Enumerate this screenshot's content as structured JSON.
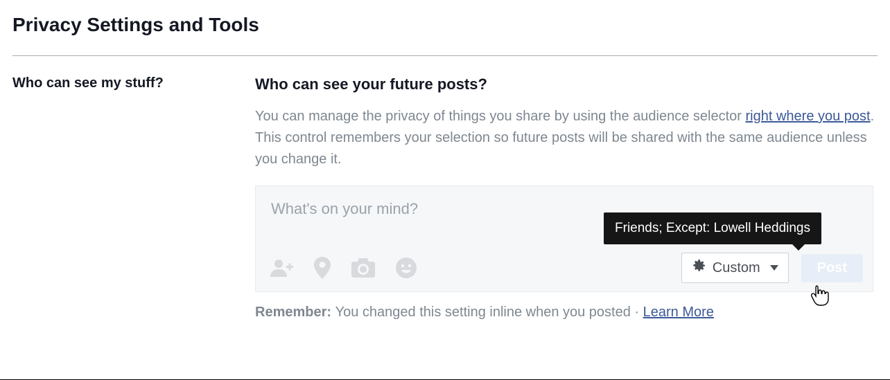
{
  "page_title": "Privacy Settings and Tools",
  "left_section_title": "Who can see my stuff?",
  "question": "Who can see your future posts?",
  "desc_part1": "You can manage the privacy of things you share by using the audience selector ",
  "desc_link": "right where you post",
  "desc_part2": ". This control remembers your selection so future posts will be shared with the same audience unless you change it.",
  "composer_placeholder": "What's on your mind?",
  "tooltip_text": "Friends; Except: Lowell Heddings",
  "audience_label": "Custom",
  "post_label": "Post",
  "remember_label": "Remember: ",
  "remember_text": "You changed this setting inline when you posted",
  "remember_sep": " · ",
  "learn_more": "Learn More"
}
